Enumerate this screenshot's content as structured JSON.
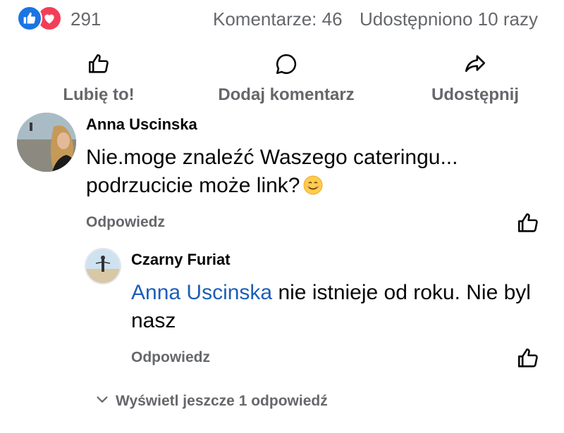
{
  "reactions": {
    "count": "291",
    "comments": "Komentarze: 46",
    "shares": "Udostępniono 10 razy"
  },
  "actions": {
    "like": "Lubię to!",
    "comment": "Dodaj komentarz",
    "share": "Udostępnij"
  },
  "comment1": {
    "author": "Anna Uscinska",
    "text": "Nie.moge znaleźć Waszego cateringu... podrzucicie może link?",
    "reply_label": "Odpowiedz"
  },
  "comment2": {
    "author": "Czarny Furiat",
    "mention": "Anna Uscinska",
    "text": " nie istnieje od roku. Nie byl nasz",
    "reply_label": "Odpowiedz"
  },
  "more_replies": "Wyświetl jeszcze 1 odpowiedź",
  "colors": {
    "like_blue": "#1b74e4",
    "love_red": "#f33e58",
    "muted_text": "#65676b",
    "mention_blue": "#1b5fb8"
  },
  "icons": [
    "like-reaction-icon",
    "love-reaction-icon",
    "thumb-up-icon",
    "speech-bubble-icon",
    "share-arrow-icon",
    "smiling-emoji-icon",
    "chevron-down-icon"
  ]
}
